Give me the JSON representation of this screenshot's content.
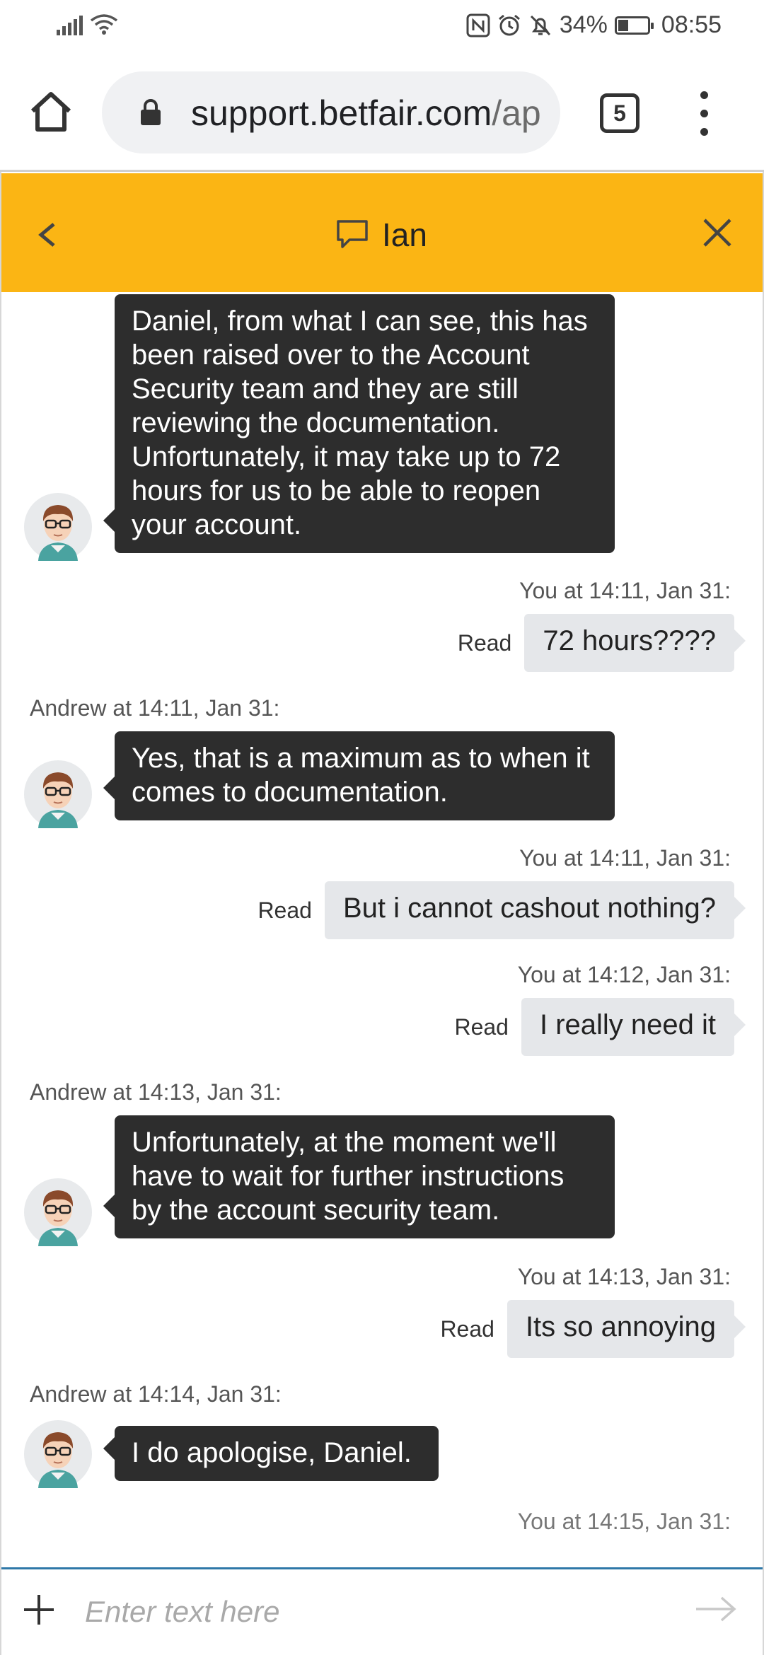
{
  "status_bar": {
    "battery": "34%",
    "battery_level": 0.34,
    "time": "08:55"
  },
  "browser": {
    "url_main": "support.betfair.com",
    "url_rest": "/ap",
    "tab_count": "5"
  },
  "chat": {
    "agent_name": "Ian",
    "messages": [
      {
        "type": "agent",
        "text": "Daniel, from what I can see, this has been raised over to the Account Security team and they are still reviewing the documentation. Unfortunately, it may take up to 72 hours for us to be able to reopen your account."
      },
      {
        "type": "user",
        "meta": "You at 14:11, Jan 31:",
        "status": "Read",
        "text": "72 hours????"
      },
      {
        "type": "agent",
        "meta": "Andrew at 14:11, Jan 31:",
        "text": "Yes, that is a maximum as to when it comes to documentation."
      },
      {
        "type": "user",
        "meta": "You at 14:11, Jan 31:",
        "status": "Read",
        "text": "But i cannot cashout nothing?"
      },
      {
        "type": "user",
        "meta": "You at 14:12, Jan 31:",
        "status": "Read",
        "text": "I really need it"
      },
      {
        "type": "agent",
        "meta": "Andrew at 14:13, Jan 31:",
        "text": "Unfortunately, at the moment we'll have to wait for further instructions by the account security team."
      },
      {
        "type": "user",
        "meta": "You at 14:13, Jan 31:",
        "status": "Read",
        "text": "Its so annoying"
      },
      {
        "type": "agent",
        "meta": "Andrew at 14:14, Jan 31:",
        "text": "I do apologise, Daniel."
      },
      {
        "type": "partial",
        "meta": "You at 14:15, Jan 31:"
      }
    ]
  },
  "input": {
    "placeholder": "Enter text here"
  },
  "colors": {
    "header": "#fbb514",
    "agent_bubble": "#2d2d2d",
    "user_bubble": "#e5e7ea",
    "input_border": "#2f78a8"
  },
  "icons": [
    "signal-icon",
    "wifi-icon",
    "nfc-icon",
    "alarm-icon",
    "mute-icon",
    "battery-icon",
    "home-icon",
    "lock-icon",
    "overflow-menu-icon",
    "back-icon",
    "chat-icon",
    "close-icon",
    "avatar-icon",
    "plus-icon",
    "send-icon"
  ]
}
